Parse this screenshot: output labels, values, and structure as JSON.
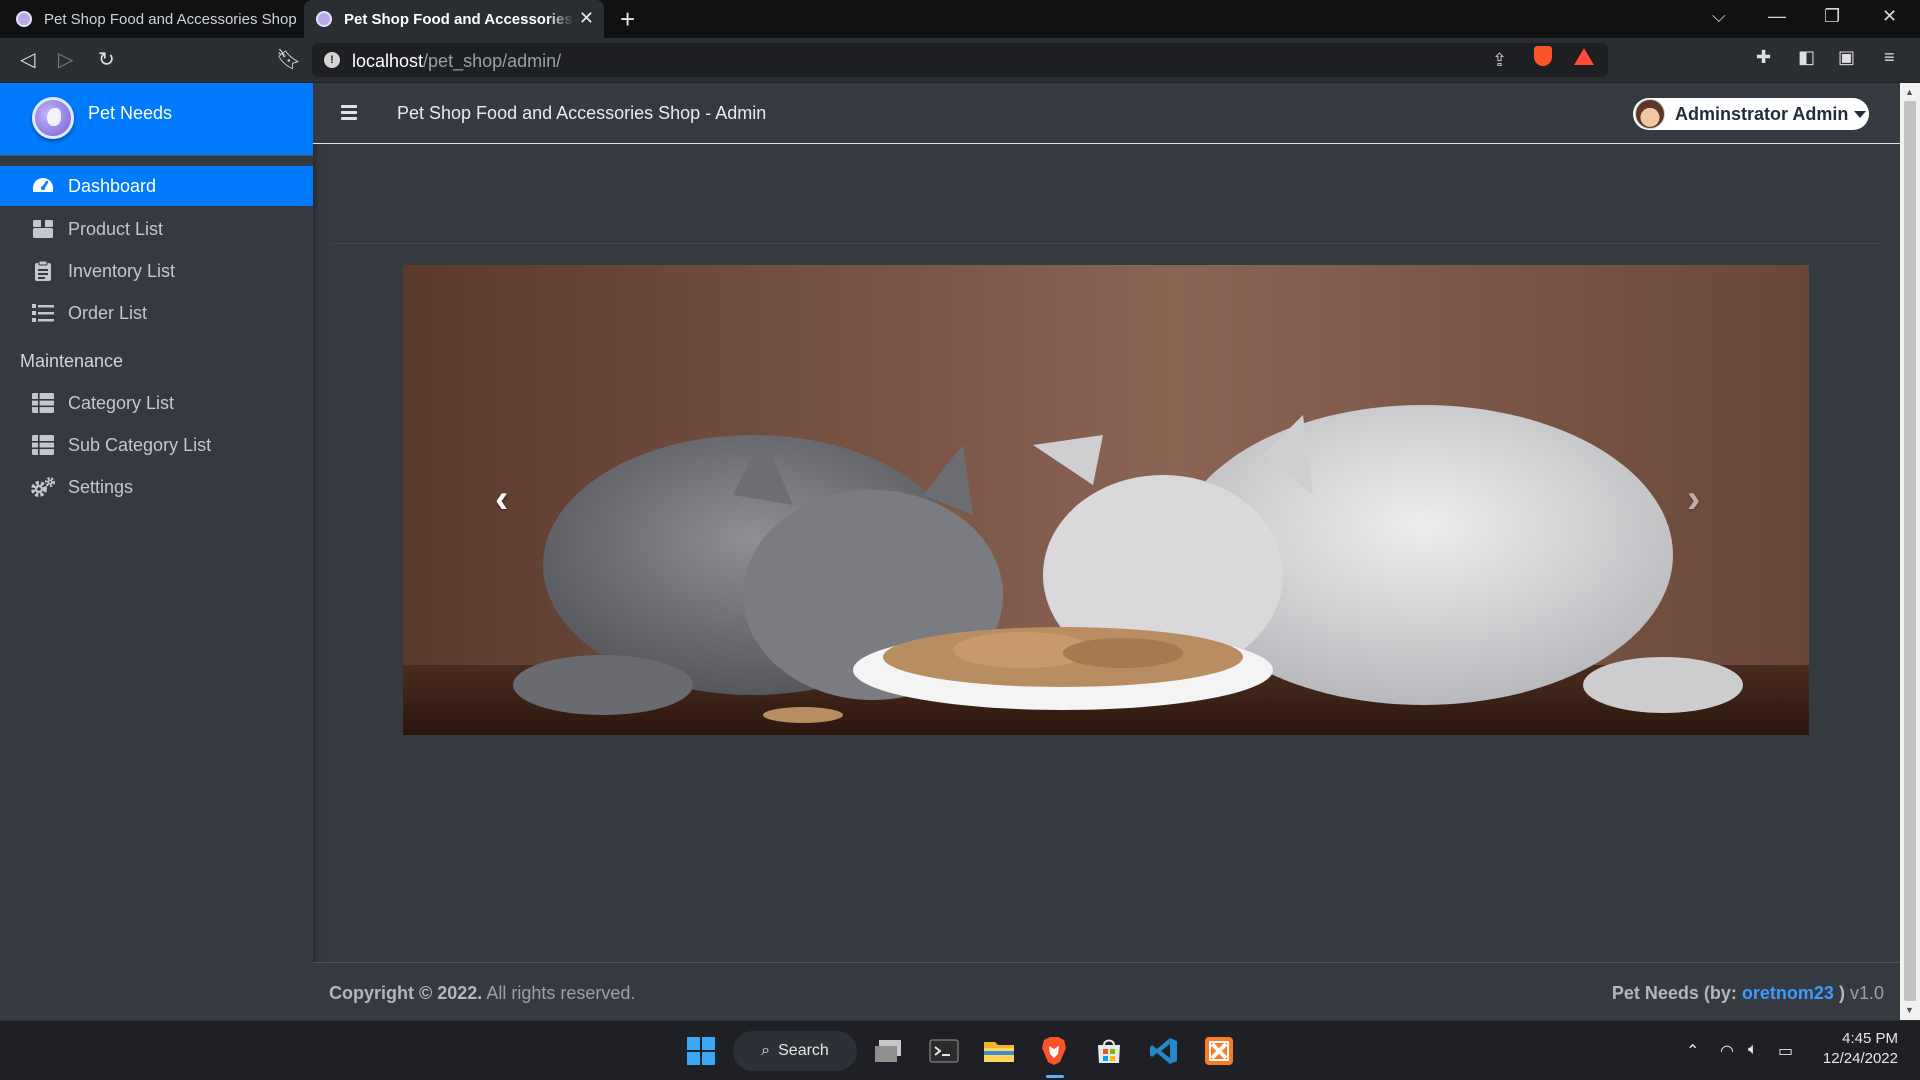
{
  "browser": {
    "tabs": [
      {
        "title": "Pet Shop Food and Accessories Shop",
        "active": false
      },
      {
        "title": "Pet Shop Food and Accessories Shop",
        "active": true
      }
    ],
    "url_host": "localhost",
    "url_path": "/pet_shop/admin/"
  },
  "sidebar": {
    "brand": "Pet Needs",
    "items": [
      {
        "label": "Dashboard",
        "icon": "dashboard-icon",
        "active": true
      },
      {
        "label": "Product List",
        "icon": "box-icon"
      },
      {
        "label": "Inventory List",
        "icon": "clipboard-list-icon"
      },
      {
        "label": "Order List",
        "icon": "list-icon"
      }
    ],
    "section_header": "Maintenance",
    "maintenance_items": [
      {
        "label": "Category List",
        "icon": "table-icon"
      },
      {
        "label": "Sub Category List",
        "icon": "table-icon"
      },
      {
        "label": "Settings",
        "icon": "cogs-icon"
      }
    ]
  },
  "header": {
    "title": "Pet Shop Food and Accessories Shop - Admin",
    "user_name": "Adminstrator Admin"
  },
  "carousel": {
    "image_subject": "two kittens eating dry food from a white plate"
  },
  "footer": {
    "copyright_bold": "Copyright © 2022.",
    "copyright_rest": "All rights reserved.",
    "brand_prefix": "Pet Needs (by:",
    "author": "oretnom23",
    "brand_suffix": ")",
    "version": "v1.0"
  },
  "taskbar": {
    "search_label": "Search",
    "time": "4:45 PM",
    "date": "12/24/2022"
  },
  "colors": {
    "primary": "#007bff",
    "sidebar_bg": "#343a40",
    "link": "#3d9bff"
  }
}
